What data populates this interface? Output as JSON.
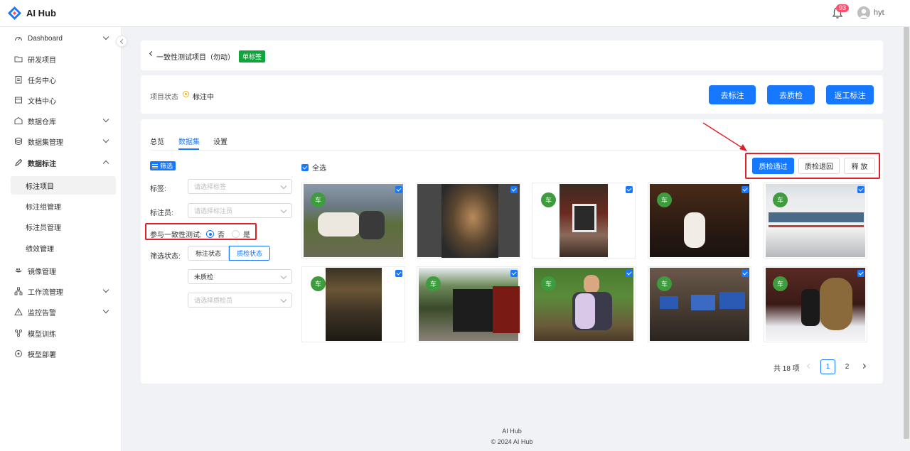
{
  "app": {
    "title": "AI Hub",
    "notification_count": "93",
    "user": "hyt"
  },
  "sidebar": {
    "items": [
      {
        "label": "Dashboard",
        "icon": "dashboard-icon",
        "chevron": "down"
      },
      {
        "label": "研发项目",
        "icon": "folder-icon"
      },
      {
        "label": "任务中心",
        "icon": "clipboard-icon"
      },
      {
        "label": "文档中心",
        "icon": "document-icon"
      },
      {
        "label": "数据仓库",
        "icon": "warehouse-icon",
        "chevron": "down"
      },
      {
        "label": "数据集管理",
        "icon": "database-icon",
        "chevron": "down"
      },
      {
        "label": "数据标注",
        "icon": "annotate-icon",
        "chevron": "up"
      },
      {
        "label": "标注项目",
        "sub": true,
        "active": true
      },
      {
        "label": "标注组管理",
        "sub": true
      },
      {
        "label": "标注员管理",
        "sub": true
      },
      {
        "label": "绩效管理",
        "sub": true
      },
      {
        "label": "镜像管理",
        "icon": "image-registry-icon"
      },
      {
        "label": "工作流管理",
        "icon": "workflow-icon",
        "chevron": "down"
      },
      {
        "label": "监控告警",
        "icon": "alert-icon",
        "chevron": "down"
      },
      {
        "label": "模型训练",
        "icon": "training-icon"
      },
      {
        "label": "模型部署",
        "icon": "deploy-icon"
      }
    ]
  },
  "breadcrumb": {
    "title": "一致性测试项目（勿动）",
    "tag": "单标签"
  },
  "project": {
    "state_label": "项目状态",
    "state_value": "标注中",
    "buttons": [
      "去标注",
      "去质检",
      "返工标注"
    ]
  },
  "tabs": [
    "总览",
    "数据集",
    "设置"
  ],
  "filters": {
    "tag": "筛选",
    "label_label": "标签:",
    "label_placeholder": "请选择标签",
    "annotator_label": "标注员:",
    "annotator_placeholder": "请选择标注员",
    "consistency_label": "参与一致性测试:",
    "consistency_options": [
      "否",
      "是"
    ],
    "status_label": "筛选状态:",
    "status_segments": [
      "标注状态",
      "质检状态"
    ],
    "qc_status_value": "未质检",
    "qc_person_placeholder": "请选择质检员"
  },
  "toolbar": {
    "select_all": "全选",
    "actions": [
      "质检通过",
      "质检退回",
      "释 放"
    ]
  },
  "images": [
    {
      "label": "车",
      "desc": "cow-and-people"
    },
    {
      "label": "",
      "desc": "child-dark"
    },
    {
      "label": "车",
      "desc": "window-flowers"
    },
    {
      "label": "车",
      "desc": "white-cat"
    },
    {
      "label": "车",
      "desc": "bus"
    },
    {
      "label": "车",
      "desc": "water-sunset"
    },
    {
      "label": "车",
      "desc": "steam-train"
    },
    {
      "label": "车",
      "desc": "father-child"
    },
    {
      "label": "车",
      "desc": "computer-desk"
    },
    {
      "label": "车",
      "desc": "woman-bear-statue"
    }
  ],
  "pagination": {
    "total": "共 18 项",
    "pages": [
      "1",
      "2"
    ],
    "current": "1"
  },
  "footer": {
    "line1": "AI Hub",
    "line2": "© 2024 AI Hub"
  },
  "colors": {
    "primary": "#1677ff",
    "highlight": "#e0202a",
    "tag_green": "#13a33b",
    "label_green": "#3e9b3e"
  }
}
